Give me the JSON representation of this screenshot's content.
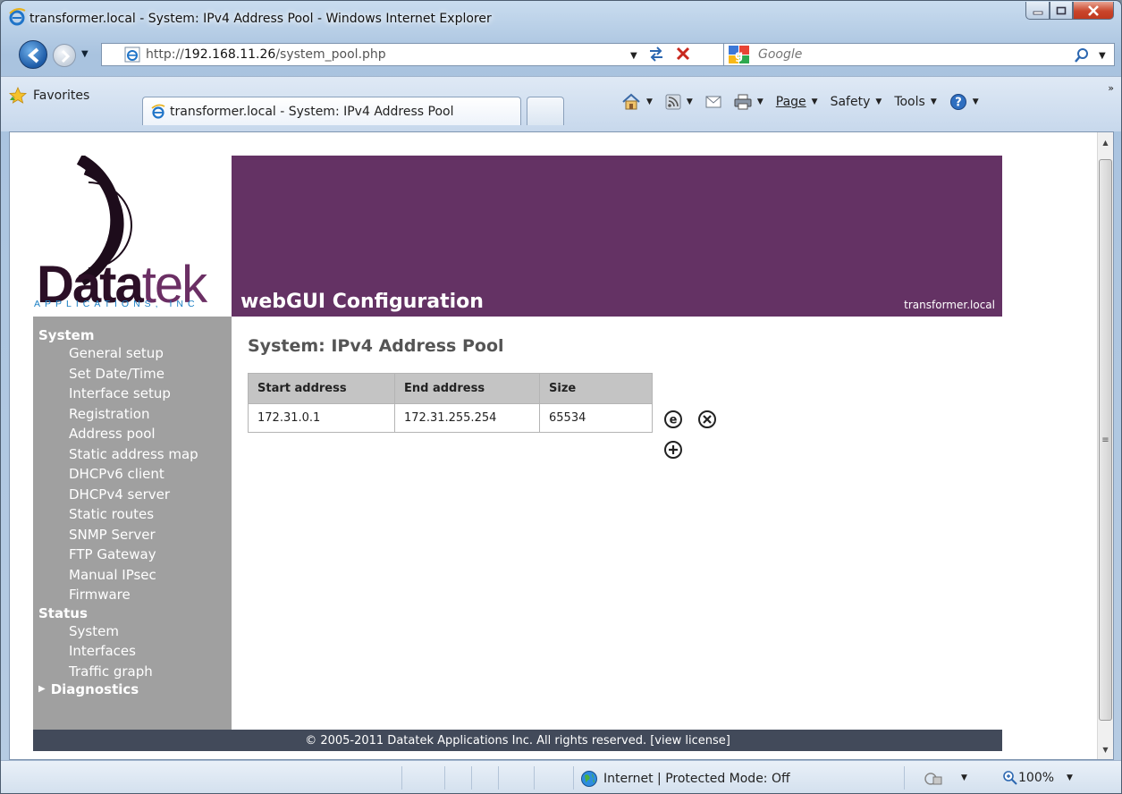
{
  "window": {
    "title": "transformer.local - System: IPv4 Address Pool - Windows Internet Explorer"
  },
  "address_bar": {
    "url_prefix": "http://",
    "url_host": "192.168.11.26",
    "url_path": "/system_pool.php",
    "search_placeholder": "Google"
  },
  "favorites_bar": {
    "favorites_label": "Favorites",
    "tab_title": "transformer.local - System: IPv4 Address Pool",
    "commands": [
      "Page",
      "Safety",
      "Tools"
    ]
  },
  "brand": {
    "name_dark": "Data",
    "name_light": "tek",
    "subtitle": "APPLICATIONS, INC"
  },
  "banner": {
    "title": "webGUI Configuration",
    "hostname": "transformer.local"
  },
  "sidebar": {
    "system_label": "System",
    "system_items": [
      "General setup",
      "Set Date/Time",
      "Interface setup",
      "Registration",
      "Address pool",
      "Static address map",
      "DHCPv6 client",
      "DHCPv4 server",
      "Static routes",
      "SNMP Server",
      "FTP Gateway",
      "Manual IPsec",
      "Firmware"
    ],
    "status_label": "Status",
    "status_items": [
      "System",
      "Interfaces",
      "Traffic graph"
    ],
    "diagnostics_label": "Diagnostics"
  },
  "main": {
    "page_title": "System: IPv4 Address Pool",
    "table": {
      "headers": [
        "Start address",
        "End address",
        "Size"
      ],
      "rows": [
        [
          "172.31.0.1",
          "172.31.255.254",
          "65534"
        ]
      ]
    }
  },
  "footer": {
    "text": "© 2005-2011 Datatek Applications Inc. All rights reserved.   [view license]"
  },
  "status_bar": {
    "zone_text": "Internet | Protected Mode: Off",
    "zoom": "100%"
  },
  "colors": {
    "banner": "#643264",
    "sidebar": "#a0a0a0",
    "footer": "#424a5a",
    "brand_accent": "#1a7fc4"
  }
}
